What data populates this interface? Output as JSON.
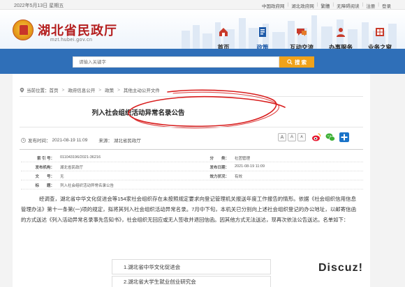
{
  "topbar": {
    "date": "2022年5月13日 星期五",
    "links": [
      "中国政府网",
      "湖北政府网",
      "繁體",
      "无障碍阅读",
      "注册",
      "登录"
    ]
  },
  "header": {
    "site_title": "湖北省民政厅",
    "site_url": "mzt.hubei.gov.cn"
  },
  "nav": [
    {
      "label": "首页",
      "icon": "home-icon",
      "active": false
    },
    {
      "label": "政策",
      "icon": "policy-icon",
      "active": true
    },
    {
      "label": "互动交流",
      "icon": "chat-icon",
      "active": false
    },
    {
      "label": "办事服务",
      "icon": "service-icon",
      "active": false
    },
    {
      "label": "业务之窗",
      "icon": "window-icon",
      "active": false
    }
  ],
  "search": {
    "placeholder": "请输入关键字",
    "button_label": "搜 索"
  },
  "breadcrumb": {
    "prefix": "当前位置：",
    "items": [
      "首页",
      "政府信息公开",
      "政策",
      "其他主动公开文件"
    ]
  },
  "article": {
    "title": "列入社会组织活动异常名录公告",
    "published_label": "发布时间：",
    "published": "2021-08-19 11:09",
    "source_label": "来源：",
    "source": "湖北省民政厅",
    "font_buttons": [
      "A",
      "A",
      "A"
    ],
    "share_icons": [
      "weibo-icon",
      "wechat-icon",
      "plus-icon"
    ]
  },
  "info": [
    {
      "k1": "索 引 号：",
      "v1": "011043196/2021-36216",
      "k2": "分　　类：",
      "v2": "社团管理"
    },
    {
      "k1": "发布机构：",
      "v1": "湖北省民政厅",
      "k2": "发布日期：",
      "v2": "2021-08-19 11:09"
    },
    {
      "k1": "文　　号：",
      "v1": "无",
      "k2": "效力状况：",
      "v2": "有效"
    },
    {
      "k1": "标　　题：",
      "v1": "列入社会组织活动异常名录公告",
      "k2": "",
      "v2": ""
    }
  ],
  "body": {
    "paragraph": "经调查，湖北省中华文化促进会等154家社会组织存在未按照规定要求向登记管理机关报送年度工作报告的情形。依据《社会组织信用信息管理办法》第十一条第(一)项的规定，拟将其列入社会组织活动异常名录。7月中下旬，本机关已分别向上述社会组织登记的办公地址，以邮寄信函的方式送达《列入活动异常名录事先告知书》，社会组织无回应或无人签收并退回信函。因其他方式无法送达，现再次依法公告送达。名单如下：",
    "list": [
      "1.湖北省中华文化促进会",
      "2.湖北省大学生就业创业研究会"
    ]
  },
  "watermark": "Discuz!",
  "colors": {
    "brand_red": "#b41e1e",
    "nav_blue": "#1e5aa8",
    "search_band": "#2f6fb8",
    "search_button": "#f0a21a",
    "scribble_red": "#d81c1c"
  }
}
